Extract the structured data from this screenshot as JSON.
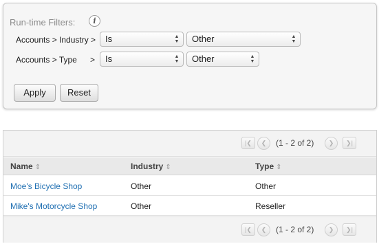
{
  "filters": {
    "title": "Run-time Filters:",
    "info_icon": "i",
    "rows": [
      {
        "label": "Accounts > Industry >",
        "operator": "Is",
        "value": "Other"
      },
      {
        "label": "Accounts > Type",
        "separator": ">",
        "operator": "Is",
        "value": "Other"
      }
    ],
    "apply_label": "Apply",
    "reset_label": "Reset"
  },
  "pager": {
    "text": "(1 - 2 of 2)",
    "first_icon": "first-page-icon",
    "prev_icon": "prev-page-icon",
    "next_icon": "next-page-icon",
    "last_icon": "last-page-icon"
  },
  "table": {
    "columns": [
      "Name",
      "Industry",
      "Type"
    ],
    "rows": [
      {
        "name": "Moe's Bicycle Shop",
        "industry": "Other",
        "type": "Other"
      },
      {
        "name": "Mike's Motorcycle Shop",
        "industry": "Other",
        "type": "Reseller"
      }
    ]
  },
  "colors": {
    "link": "#1f6fb2",
    "panel_bg": "#f6f6f6",
    "header_bg": "#e9e9e9"
  }
}
